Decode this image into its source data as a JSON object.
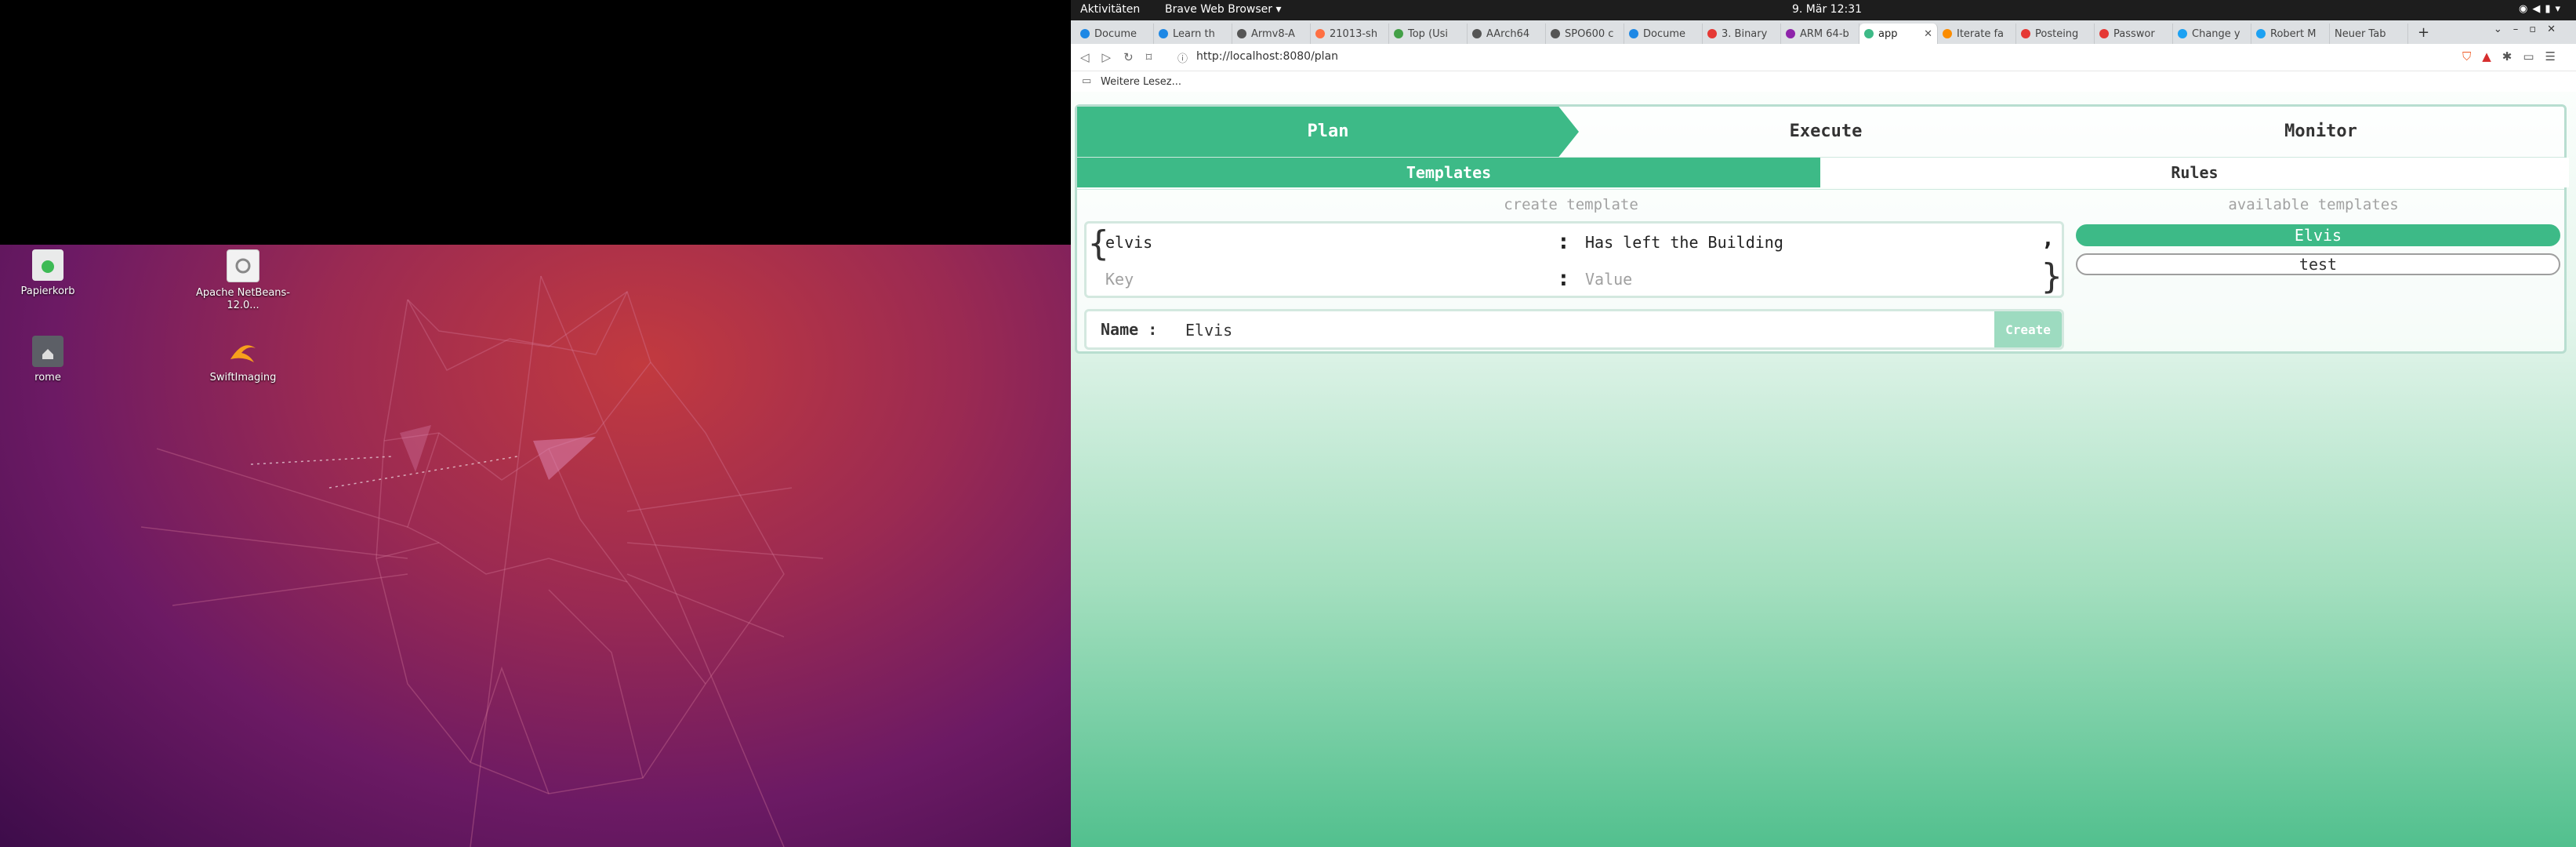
{
  "desktop": {
    "icons": [
      {
        "name": "trash",
        "label": "Papierkorb"
      },
      {
        "name": "netbeans",
        "label": "Apache NetBeans-12.0..."
      },
      {
        "name": "home",
        "label": "rome"
      },
      {
        "name": "swiftimaging",
        "label": "SwiftImaging"
      }
    ]
  },
  "topbar": {
    "activities": "Aktivitäten",
    "app_menu": "Brave Web Browser ▾",
    "clock": "9. Mär  12:31"
  },
  "tabs": [
    {
      "label": "Docume",
      "color": "#1e88e5"
    },
    {
      "label": "Learn th",
      "color": "#1e88e5"
    },
    {
      "label": "Armv8-A",
      "color": "#555555"
    },
    {
      "label": "21013-sh",
      "color": "#ff7043"
    },
    {
      "label": "Top (Usi",
      "color": "#43a047"
    },
    {
      "label": "AArch64",
      "color": "#555555"
    },
    {
      "label": "SPO600 c",
      "color": "#555555"
    },
    {
      "label": "Docume",
      "color": "#1e88e5"
    },
    {
      "label": "3. Binary",
      "color": "#e53935"
    },
    {
      "label": "ARM 64-b",
      "color": "#8e24aa"
    },
    {
      "label": "app",
      "color": "#3dba87",
      "active": true
    },
    {
      "label": "Iterate fa",
      "color": "#fb8c00"
    },
    {
      "label": "Posteing",
      "color": "#e53935"
    },
    {
      "label": "Passwor",
      "color": "#e53935"
    },
    {
      "label": "Change y",
      "color": "#1da1f2"
    },
    {
      "label": "Robert M",
      "color": "#1da1f2"
    },
    {
      "label": "Neuer Tab",
      "color": ""
    }
  ],
  "address": {
    "url": "http://localhost:8080/plan"
  },
  "bookmarks": {
    "folder_label": "Weitere Lesez..."
  },
  "app": {
    "nav": {
      "plan": "Plan",
      "execute": "Execute",
      "monitor": "Monitor"
    },
    "subnav": {
      "templates": "Templates",
      "rules": "Rules"
    },
    "create_section": "create template",
    "available_section": "available templates",
    "kv": {
      "open_brace": "{",
      "close_brace": "}",
      "comma": ",",
      "colon": ":",
      "rows": [
        {
          "key": "elvis",
          "value": "Has left the Building"
        }
      ],
      "key_placeholder": "Key",
      "value_placeholder": "Value"
    },
    "name_label": "Name :",
    "name_value": "Elvis",
    "create_button": "Create",
    "templates": [
      {
        "label": "Elvis",
        "selected": true
      },
      {
        "label": "test",
        "selected": false
      }
    ]
  }
}
